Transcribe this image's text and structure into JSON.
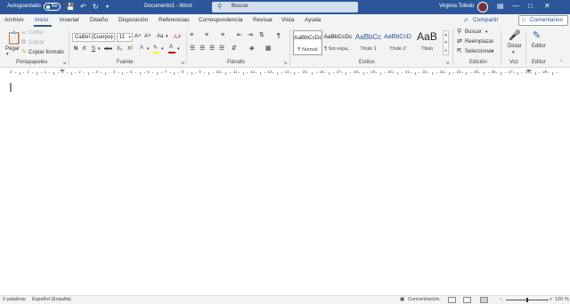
{
  "titlebar": {
    "autosave_label": "Autoguardado",
    "autosave_state": "No",
    "document_title": "Documento1 - Word",
    "search_placeholder": "Buscar",
    "user_name": "Virginia Toledo",
    "qat_icons": [
      "save-icon",
      "undo-icon",
      "redo-icon",
      "customize-icon"
    ],
    "window_controls": [
      "ribbon-display-icon",
      "minimize-icon",
      "maximize-icon",
      "close-icon"
    ]
  },
  "tabs": [
    "Archivo",
    "Inicio",
    "Insertar",
    "Diseño",
    "Disposición",
    "Referencias",
    "Correspondencia",
    "Revisar",
    "Vista",
    "Ayuda"
  ],
  "active_tab": "Inicio",
  "share_label": "Compartir",
  "comments_label": "Comentarios",
  "ribbon": {
    "clipboard": {
      "label": "Portapapeles",
      "paste": "Pegar",
      "cut": "Cortar",
      "copy": "Copiar",
      "format_painter": "Copiar formato"
    },
    "font": {
      "label": "Fuente",
      "font_name": "Calibri (Cuerpo)",
      "font_size": "11",
      "grow": "A˄",
      "shrink": "A˅",
      "case": "Aa",
      "bold": "N",
      "italic": "K",
      "underline": "S",
      "strike": "abc",
      "subscript": "X₂",
      "superscript": "X²",
      "highlight_color": "#ffff00",
      "font_color": "#c00000"
    },
    "paragraph": {
      "label": "Párrafo",
      "show_marks": "¶"
    },
    "styles": {
      "label": "Estilos",
      "items": [
        {
          "sample": "AaBbCcDc",
          "name": "¶ Normal"
        },
        {
          "sample": "AaBbCcDc",
          "name": "¶ Sin espa..."
        },
        {
          "sample": "AaBbCc",
          "name": "Título 1"
        },
        {
          "sample": "AaBbCcD",
          "name": "Título 2"
        },
        {
          "sample": "AaB",
          "name": "Título"
        }
      ]
    },
    "editing": {
      "label": "Edición",
      "find": "Buscar",
      "replace": "Reemplazar",
      "select": "Seleccionar"
    },
    "voice": {
      "label": "Voz",
      "dictate": "Dictar"
    },
    "editor": {
      "label": "Editor",
      "editor": "Editor"
    }
  },
  "ruler_numbers": [
    "3",
    "2",
    "1",
    "1",
    "2",
    "3",
    "4",
    "5",
    "6",
    "7",
    "8",
    "9",
    "10",
    "11",
    "12",
    "13",
    "14",
    "15",
    "16",
    "17",
    "18",
    "19",
    "20",
    "21",
    "22",
    "23",
    "24",
    "25",
    "26",
    "27",
    "28",
    "29"
  ],
  "status": {
    "words": "0 palabras",
    "language": "Español (España)",
    "focus": "Concentración",
    "zoom": "120 %",
    "zoom_out": "−",
    "zoom_in": "+",
    "zoom_fraction": 0.5
  },
  "colors": {
    "accent": "#2b579a",
    "title_bar": "#2b579a",
    "ribbon_bg": "#f3f3f3"
  }
}
